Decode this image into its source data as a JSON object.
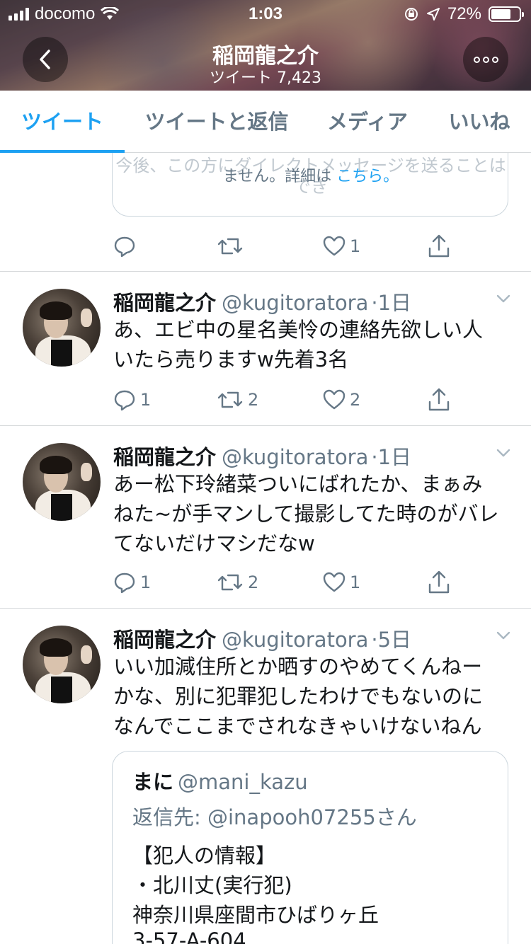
{
  "status_bar": {
    "carrier": "docomo",
    "time": "1:03",
    "battery": "72%"
  },
  "header": {
    "title": "稲岡龍之介",
    "subtitle": "ツイート 7,423"
  },
  "tabs": [
    {
      "label": "ツイート",
      "active": true
    },
    {
      "label": "ツイートと返信",
      "active": false
    },
    {
      "label": "メディア",
      "active": false
    },
    {
      "label": "いいね",
      "active": false
    }
  ],
  "top_card": {
    "cut_text": "今後、この方にダイレクトメッセージを送ることはでき",
    "line2_text": "ません。詳細は",
    "link_text": "こちら。"
  },
  "top_actions": {
    "reply": "",
    "retweet": "",
    "like": "1"
  },
  "tweets": [
    {
      "name": "稲岡龍之介",
      "handle": "@kugitoratora",
      "time": "1日",
      "text": [
        "あ、エビ中の星名美怜の連絡先欲しい人",
        "いたら売りますw先着3名"
      ],
      "reply": "1",
      "retweet": "2",
      "like": "2"
    },
    {
      "name": "稲岡龍之介",
      "handle": "@kugitoratora",
      "time": "1日",
      "text": [
        "あー松下玲緒菜ついにばれたか、まぁみ",
        "ねた~が手マンして撮影してた時のがバレ",
        "てないだけマシだなw"
      ],
      "reply": "1",
      "retweet": "2",
      "like": "1"
    },
    {
      "name": "稲岡龍之介",
      "handle": "@kugitoratora",
      "time": "5日",
      "text": [
        "いい加減住所とか晒すのやめてくんねー",
        "かな、別に犯罪犯したわけでもないのに",
        "なんでここまでされなきゃいけないねん"
      ]
    }
  ],
  "quote": {
    "name": "まに",
    "handle": "@mani_kazu",
    "reply_to": "返信先: @inapooh07255さん",
    "lines": [
      "【犯人の情報】",
      "・北川丈(実行犯)",
      "神奈川県座間市ひばりヶ丘",
      "3-57-A-604"
    ]
  },
  "colors": {
    "accent": "#1da1f2",
    "secondary_text": "#657786",
    "divider": "#d6d9db"
  }
}
